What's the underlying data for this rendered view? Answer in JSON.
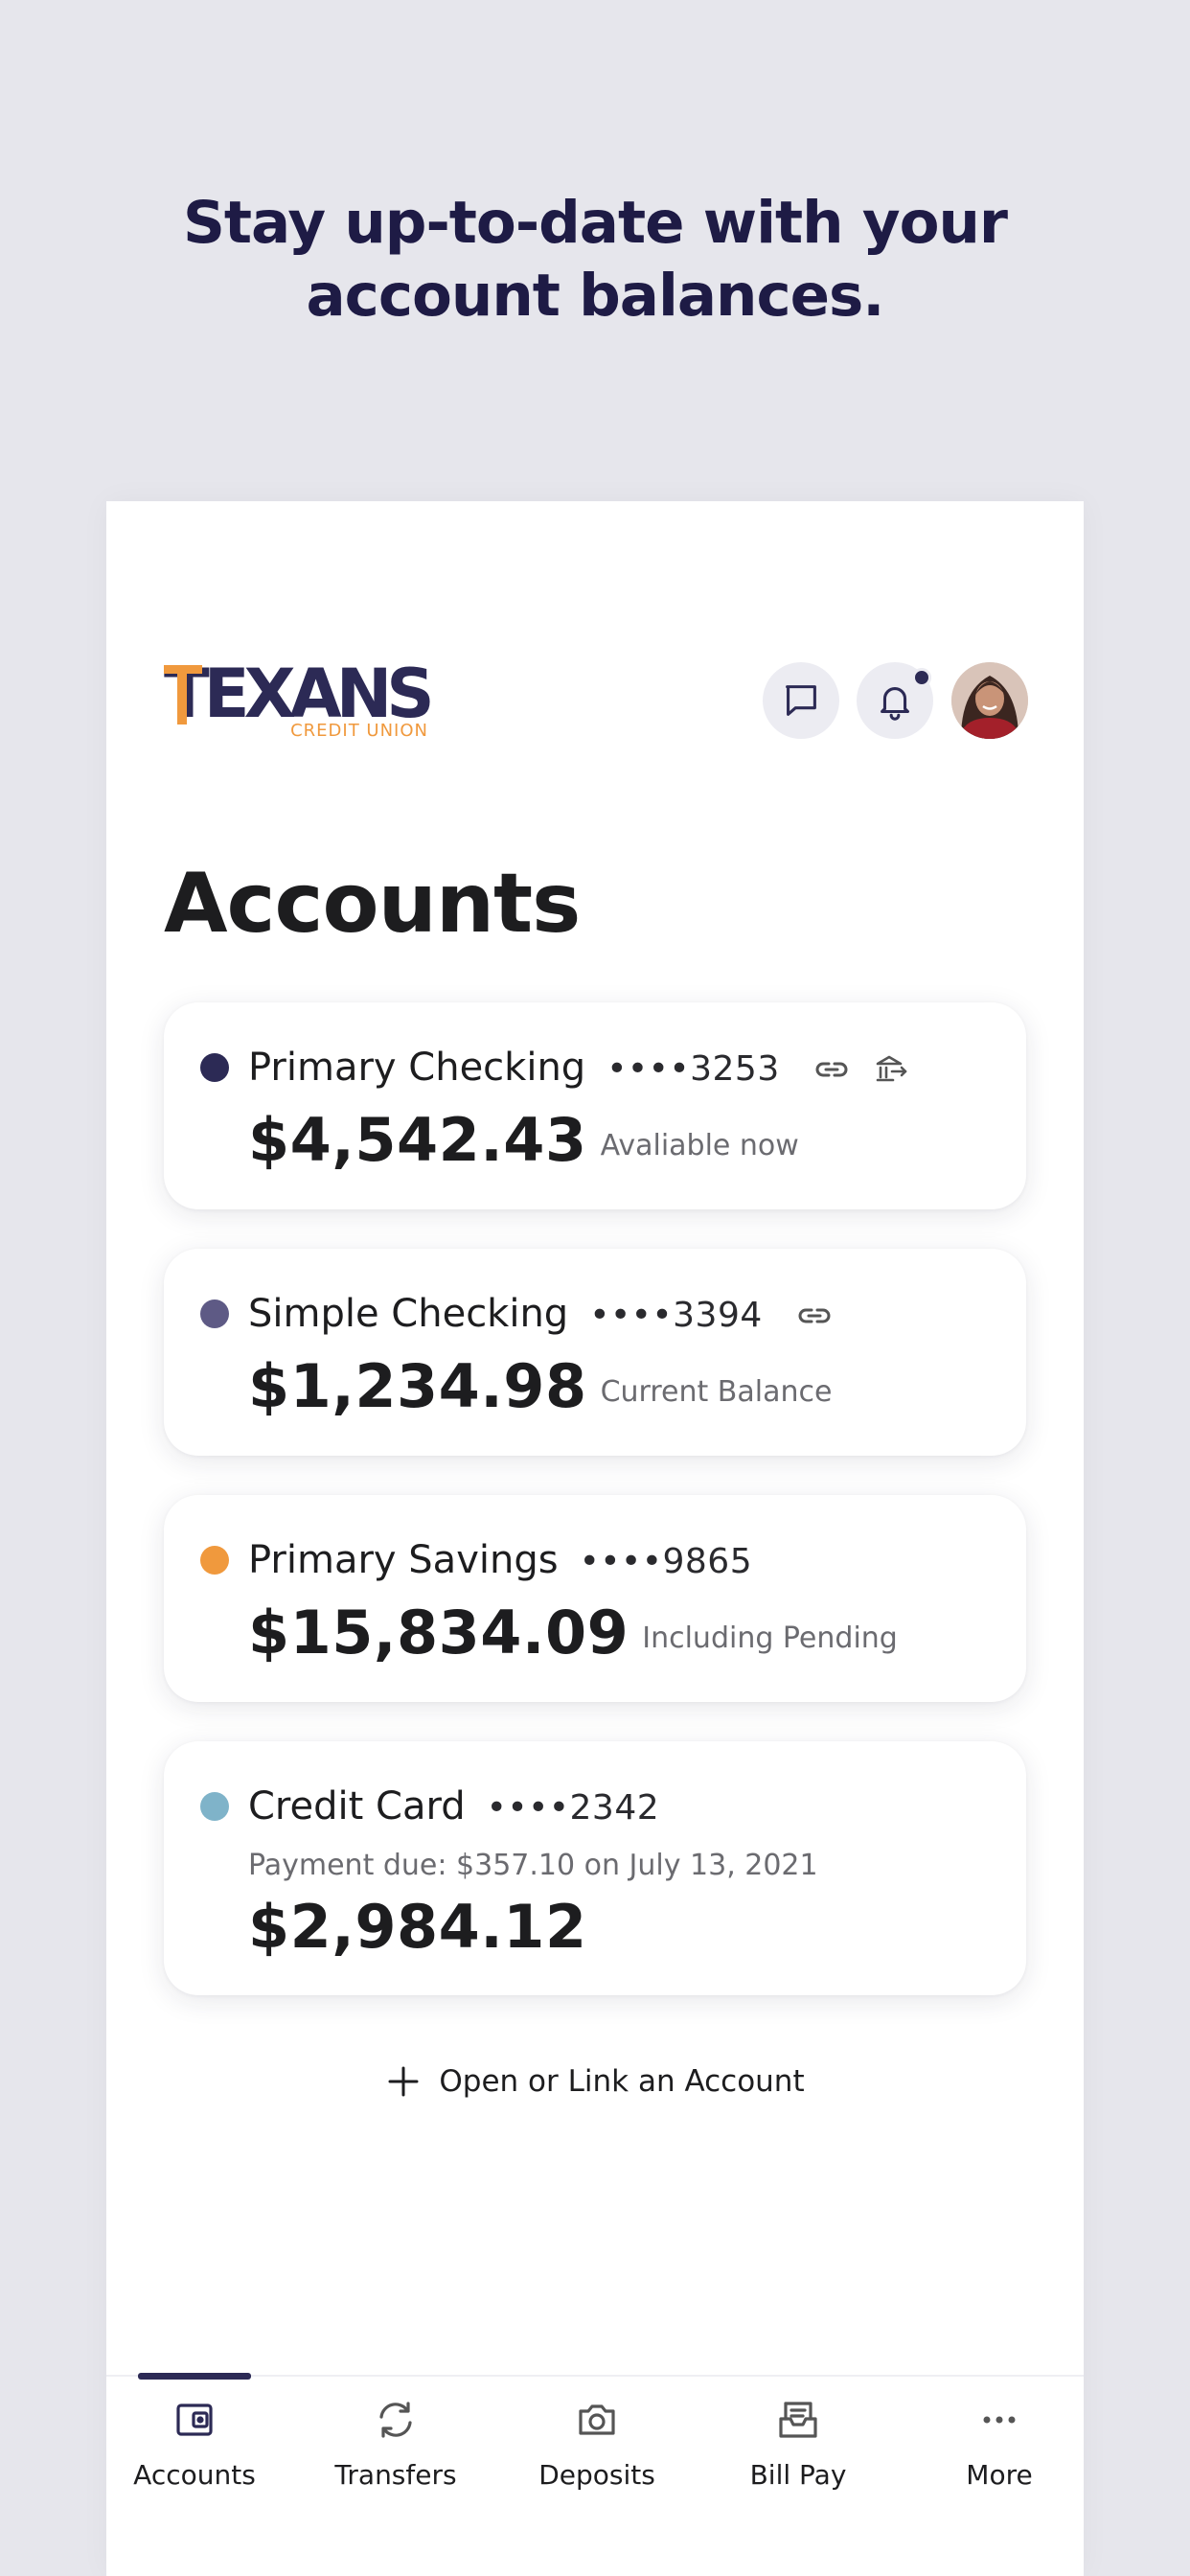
{
  "headline": {
    "line1": "Stay up-to-date with your",
    "line2": "account balances."
  },
  "header": {
    "logo_main": "TEXANS",
    "logo_sub": "CREDIT UNION",
    "icons": [
      "chat-icon",
      "bell-icon",
      "avatar"
    ],
    "notification_dot": true
  },
  "page": {
    "title": "Accounts"
  },
  "accounts": [
    {
      "name": "Primary Checking",
      "mask": "••••3253",
      "amount": "$4,542.43",
      "note": "Avaliable now",
      "color": "#2c2a55",
      "icons": [
        "link-icon",
        "bank-transfer-icon"
      ]
    },
    {
      "name": "Simple Checking",
      "mask": "••••3394",
      "amount": "$1,234.98",
      "note": "Current Balance",
      "color": "#5e5a85",
      "icons": [
        "link-icon"
      ]
    },
    {
      "name": "Primary Savings",
      "mask": "••••9865",
      "amount": "$15,834.09",
      "note": "Including Pending",
      "color": "#f0993d",
      "icons": []
    },
    {
      "name": "Credit Card",
      "mask": "••••2342",
      "due": "Payment due: $357.10 on July 13, 2021",
      "amount": "$2,984.12",
      "color": "#7fb3c9",
      "icons": []
    }
  ],
  "open_link": {
    "label": "Open or Link an Account",
    "icon": "plus-icon"
  },
  "nav": {
    "active": "Accounts",
    "items": [
      {
        "label": "Accounts",
        "icon": "wallet-icon"
      },
      {
        "label": "Transfers",
        "icon": "transfer-icon"
      },
      {
        "label": "Deposits",
        "icon": "camera-icon"
      },
      {
        "label": "Bill Pay",
        "icon": "bill-icon"
      },
      {
        "label": "More",
        "icon": "more-icon"
      }
    ]
  }
}
